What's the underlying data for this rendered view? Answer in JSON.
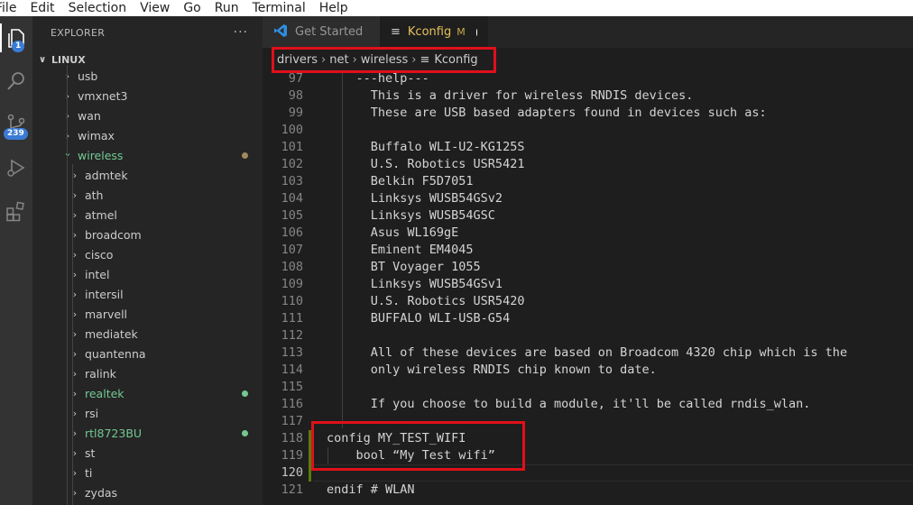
{
  "menu": [
    "File",
    "Edit",
    "Selection",
    "View",
    "Go",
    "Run",
    "Terminal",
    "Help"
  ],
  "activity": {
    "explorer_badge": "1",
    "scm_badge": "239"
  },
  "sidebar": {
    "title": "EXPLORER",
    "more": "···",
    "section": "LINUX",
    "items": [
      {
        "label": "usb",
        "level": 1,
        "color": "#cccccc"
      },
      {
        "label": "vmxnet3",
        "level": 1,
        "color": "#cccccc"
      },
      {
        "label": "wan",
        "level": 1,
        "color": "#cccccc"
      },
      {
        "label": "wimax",
        "level": 1,
        "color": "#cccccc"
      },
      {
        "label": "wireless",
        "level": 1,
        "color": "#73c991",
        "expanded": true,
        "dot": "#a0895c"
      },
      {
        "label": "admtek",
        "level": 2,
        "color": "#cccccc"
      },
      {
        "label": "ath",
        "level": 2,
        "color": "#cccccc"
      },
      {
        "label": "atmel",
        "level": 2,
        "color": "#cccccc"
      },
      {
        "label": "broadcom",
        "level": 2,
        "color": "#cccccc"
      },
      {
        "label": "cisco",
        "level": 2,
        "color": "#cccccc"
      },
      {
        "label": "intel",
        "level": 2,
        "color": "#cccccc"
      },
      {
        "label": "intersil",
        "level": 2,
        "color": "#cccccc"
      },
      {
        "label": "marvell",
        "level": 2,
        "color": "#cccccc"
      },
      {
        "label": "mediatek",
        "level": 2,
        "color": "#cccccc"
      },
      {
        "label": "quantenna",
        "level": 2,
        "color": "#cccccc"
      },
      {
        "label": "ralink",
        "level": 2,
        "color": "#cccccc"
      },
      {
        "label": "realtek",
        "level": 2,
        "color": "#73c991",
        "dot": "#73c991"
      },
      {
        "label": "rsi",
        "level": 2,
        "color": "#cccccc"
      },
      {
        "label": "rtl8723BU",
        "level": 2,
        "color": "#73c991",
        "dot": "#73c991"
      },
      {
        "label": "st",
        "level": 2,
        "color": "#cccccc"
      },
      {
        "label": "ti",
        "level": 2,
        "color": "#cccccc"
      },
      {
        "label": "zydas",
        "level": 2,
        "color": "#cccccc"
      }
    ]
  },
  "tabs": [
    {
      "label": "Get Started",
      "icon": "vscode-icon",
      "active": false
    },
    {
      "label": "Kconfig",
      "icon": "list-icon",
      "active": true,
      "status": "M"
    }
  ],
  "breadcrumb": [
    "drivers",
    "net",
    "wireless",
    "Kconfig"
  ],
  "editor": {
    "active_line": "120",
    "lines": [
      {
        "n": "97",
        "t": "    ---help---"
      },
      {
        "n": "98",
        "t": "      This is a driver for wireless RNDIS devices."
      },
      {
        "n": "99",
        "t": "      These are USB based adapters found in devices such as:"
      },
      {
        "n": "100",
        "t": ""
      },
      {
        "n": "101",
        "t": "      Buffalo WLI-U2-KG125S"
      },
      {
        "n": "102",
        "t": "      U.S. Robotics USR5421"
      },
      {
        "n": "103",
        "t": "      Belkin F5D7051"
      },
      {
        "n": "104",
        "t": "      Linksys WUSB54GSv2"
      },
      {
        "n": "105",
        "t": "      Linksys WUSB54GSC"
      },
      {
        "n": "106",
        "t": "      Asus WL169gE"
      },
      {
        "n": "107",
        "t": "      Eminent EM4045"
      },
      {
        "n": "108",
        "t": "      BT Voyager 1055"
      },
      {
        "n": "109",
        "t": "      Linksys WUSB54GSv1"
      },
      {
        "n": "110",
        "t": "      U.S. Robotics USR5420"
      },
      {
        "n": "111",
        "t": "      BUFFALO WLI-USB-G54"
      },
      {
        "n": "112",
        "t": ""
      },
      {
        "n": "113",
        "t": "      All of these devices are based on Broadcom 4320 chip which is the"
      },
      {
        "n": "114",
        "t": "      only wireless RNDIS chip known to date."
      },
      {
        "n": "115",
        "t": ""
      },
      {
        "n": "116",
        "t": "      If you choose to build a module, it'll be called rndis_wlan."
      },
      {
        "n": "117",
        "t": ""
      },
      {
        "n": "118",
        "t": "config MY_TEST_WIFI"
      },
      {
        "n": "119",
        "t": "    bool “My Test wifi”"
      },
      {
        "n": "120",
        "t": ""
      },
      {
        "n": "121",
        "t": "endif # WLAN"
      }
    ]
  }
}
